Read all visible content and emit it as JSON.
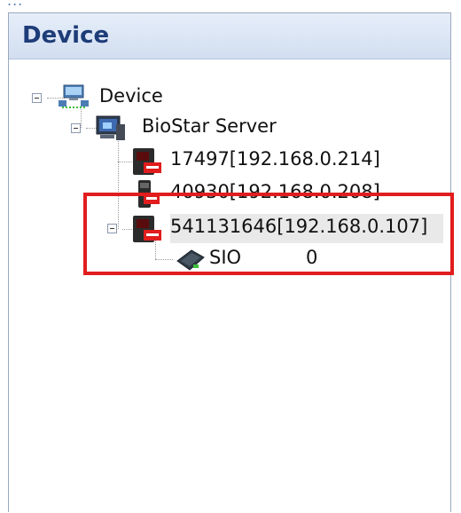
{
  "top_strip_text": "...",
  "panel": {
    "title": "Device"
  },
  "tree": {
    "root": {
      "label": "Device",
      "icon": "network-computers-icon"
    },
    "server": {
      "label": "BioStar Server",
      "icon": "server-monitor-icon"
    },
    "devices": [
      {
        "label": "17497[192.168.0.214]",
        "icon": "fingerprint-reader-icon"
      },
      {
        "label": "40930[192.168.0.208]",
        "icon": "fingerprint-reader-icon"
      },
      {
        "label": "541131646[192.168.0.107]",
        "icon": "fingerprint-reader-icon",
        "selected": true,
        "children": [
          {
            "label": "SIO",
            "value": "0",
            "icon": "sio-module-icon"
          }
        ]
      }
    ]
  },
  "highlight_color": "#e11d1d"
}
